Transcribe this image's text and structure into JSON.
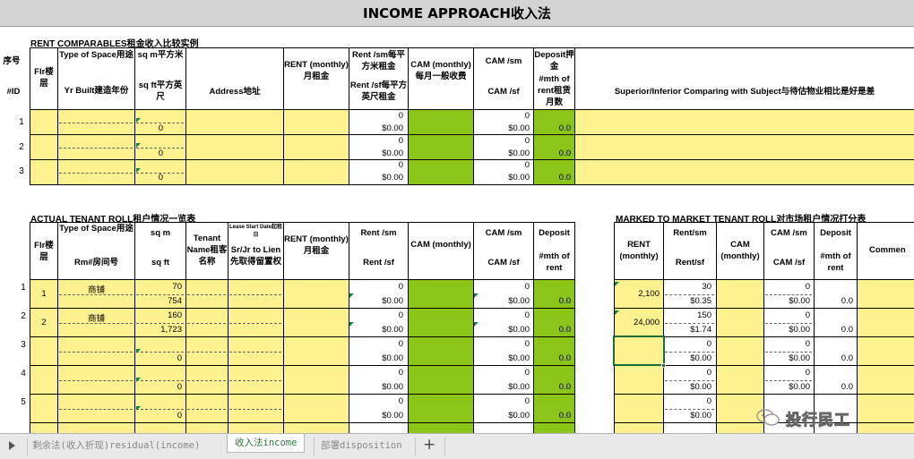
{
  "title": "INCOME APPROACH收入法",
  "rent_comparables": {
    "section_title": "RENT COMPARABLES租金收入比较实例",
    "headers": {
      "seq": "序号",
      "id": "#ID",
      "flr": "Flr楼层",
      "type_of_space": "Type of Space用途",
      "yr_built": "Yr Built建造年份",
      "sqm": "sq m平方米",
      "sqft": "sq ft平方英尺",
      "address": "Address地址",
      "rent": "RENT (monthly)月租金",
      "rent_sqm": "Rent /sm每平方米租金",
      "rent_sf": "Rent /sf每平方英尺租金",
      "cam": "CAM (monthly)每月一般收费",
      "cam_sm": "CAM /sm",
      "cam_sf": "CAM /sf",
      "deposit": "Deposit押金",
      "mth_rent": "#mth of rent租赁月数",
      "comparing": "Superior/Inferior Comparing with Subject与待估物业相比是好是差"
    },
    "rows": [
      {
        "id": "1",
        "sqft": "0",
        "rent_sm": "0",
        "rent_sf": "$0.00",
        "cam_sm": "0",
        "cam_sf": "$0.00",
        "mth": "0.0"
      },
      {
        "id": "2",
        "sqft": "0",
        "rent_sm": "0",
        "rent_sf": "$0.00",
        "cam_sm": "0",
        "cam_sf": "$0.00",
        "mth": "0.0"
      },
      {
        "id": "3",
        "sqft": "0",
        "rent_sm": "0",
        "rent_sf": "$0.00",
        "cam_sm": "0",
        "cam_sf": "$0.00",
        "mth": "0.0"
      }
    ]
  },
  "tenant_roll": {
    "section_title": "ACTUAL TENANT ROLL租户情况一览表",
    "headers": {
      "flr": "Flr楼层",
      "type_of_space": "Type of Space用途",
      "rm": "Rm#房间号",
      "sqm": "sq m",
      "sqft": "sq ft",
      "tenant": "Tenant Name租客名称",
      "lease_start": "Lease Start Date起租日",
      "sr_jr": "Sr/Jr to Lien先取得留置权",
      "rent": "RENT (monthly)月租金",
      "rent_sm": "Rent /sm",
      "rent_sf": "Rent /sf",
      "cam": "CAM (monthly)",
      "cam_sm": "CAM /sm",
      "cam_sf": "CAM /sf",
      "deposit": "Deposit",
      "mth_rent": "#mth of rent"
    },
    "rows": [
      {
        "no": "1",
        "flr": "1",
        "type": "商铺",
        "sqm": "70",
        "sqft": "754",
        "rent_sm": "0",
        "rent_sf": "$0.00",
        "cam_sm": "0",
        "cam_sf": "$0.00",
        "mth": "0.0"
      },
      {
        "no": "2",
        "flr": "2",
        "type": "商铺",
        "sqm": "160",
        "sqft": "1,723",
        "rent_sm": "0",
        "rent_sf": "$0.00",
        "cam_sm": "0",
        "cam_sf": "$0.00",
        "mth": "0.0"
      },
      {
        "no": "3",
        "flr": "",
        "type": "",
        "sqm": "",
        "sqft": "0",
        "rent_sm": "0",
        "rent_sf": "$0.00",
        "cam_sm": "0",
        "cam_sf": "$0.00",
        "mth": "0.0"
      },
      {
        "no": "4",
        "flr": "",
        "type": "",
        "sqm": "",
        "sqft": "0",
        "rent_sm": "0",
        "rent_sf": "$0.00",
        "cam_sm": "0",
        "cam_sf": "$0.00",
        "mth": "0.0"
      },
      {
        "no": "5",
        "flr": "",
        "type": "",
        "sqm": "",
        "sqft": "0",
        "rent_sm": "0",
        "rent_sf": "$0.00",
        "cam_sm": "0",
        "cam_sf": "$0.00",
        "mth": "0.0"
      }
    ]
  },
  "market_roll": {
    "section_title": "MARKED TO MARKET TENANT ROLL对市场租户情况打分表",
    "headers": {
      "rent": "RENT (monthly)",
      "rent_sm": "Rent/sm",
      "rent_sf": "Rent/sf",
      "cam": "CAM (monthly)",
      "cam_sm": "CAM /sm",
      "cam_sf": "CAM /sf",
      "deposit": "Deposit",
      "mth_rent": "#mth of rent",
      "comment": "Commen"
    },
    "rows": [
      {
        "rent": "2,100",
        "rent_sm": "30",
        "rent_sf": "$0.35",
        "cam_sm": "0",
        "cam_sf": "$0.00",
        "mth": "0.0"
      },
      {
        "rent": "24,000",
        "rent_sm": "150",
        "rent_sf": "$1.74",
        "cam_sm": "0",
        "cam_sf": "$0.00",
        "mth": "0.0"
      },
      {
        "rent": "",
        "rent_sm": "0",
        "rent_sf": "$0.00",
        "cam_sm": "0",
        "cam_sf": "$0.00",
        "mth": "0.0"
      },
      {
        "rent": "",
        "rent_sm": "0",
        "rent_sf": "$0.00",
        "cam_sm": "0",
        "cam_sf": "$0.00",
        "mth": "0.0"
      },
      {
        "rent": "",
        "rent_sm": "0",
        "rent_sf": "$0.00",
        "cam_sm": "0",
        "cam_sf": "$0.00",
        "mth": "0.0"
      }
    ]
  },
  "tabs": [
    {
      "label": "剩余法(收入折现)residual(income)",
      "active": false
    },
    {
      "label": "收入法income",
      "active": true
    },
    {
      "label": "部署disposition",
      "active": false
    }
  ],
  "add_tab_label": "+",
  "watermark": "投行民工",
  "colors": {
    "yellow": "#fef18f",
    "green": "#8bc51a",
    "header_gray": "#d4d4d4"
  }
}
